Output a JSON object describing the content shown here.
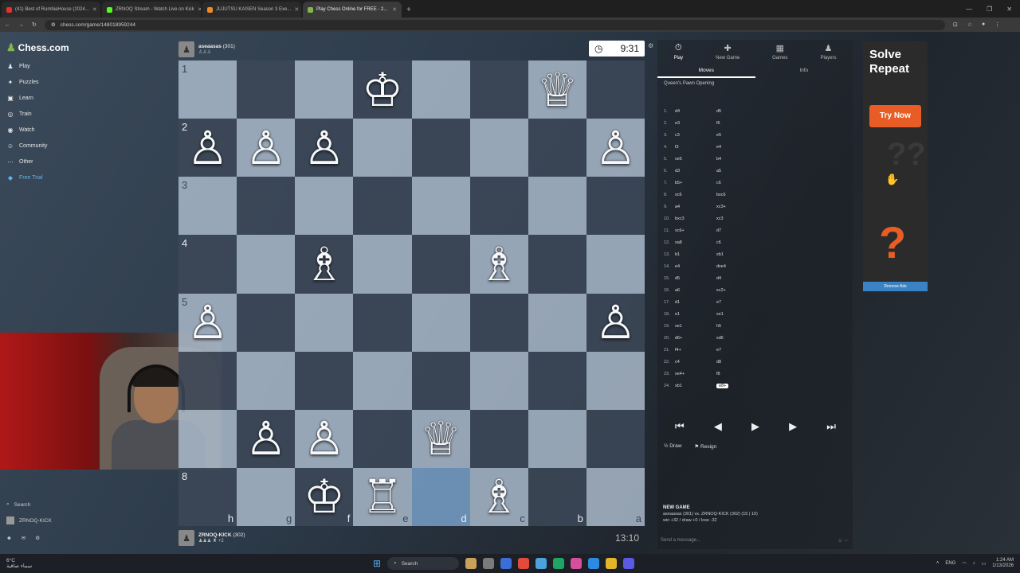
{
  "browser": {
    "tabs": [
      {
        "label": "(41) Best of RumbiaHouse (2024...",
        "color": "#e5322d",
        "active": false
      },
      {
        "label": "ZRNOQ Stream - Watch Live on Kick",
        "color": "#53fc18",
        "active": false
      },
      {
        "label": "JUJUTSU KAISEN Season 3 Exe...",
        "color": "#f08a24",
        "active": false
      },
      {
        "label": "Play Chess Online for FREE - 2...",
        "color": "#81b64c",
        "active": true
      }
    ],
    "new_tab": "+",
    "url": "chess.com/game/148018959244"
  },
  "sidebar": {
    "logo": "Chess.com",
    "items": [
      {
        "label": "Play",
        "icon": "play-icon",
        "glyph": "♟"
      },
      {
        "label": "Puzzles",
        "icon": "puzzle-icon",
        "glyph": "✦"
      },
      {
        "label": "Learn",
        "icon": "learn-icon",
        "glyph": "▣"
      },
      {
        "label": "Train",
        "icon": "train-icon",
        "glyph": "◎"
      },
      {
        "label": "Watch",
        "icon": "watch-icon",
        "glyph": "◉"
      },
      {
        "label": "Community",
        "icon": "community-icon",
        "glyph": "☺"
      },
      {
        "label": "Other",
        "icon": "more-icon",
        "glyph": "⋯"
      },
      {
        "label": "Free Trial",
        "icon": "diamond-icon",
        "glyph": "◆"
      }
    ],
    "search": "Search",
    "user": "ZRNOQ-KICK"
  },
  "board": {
    "ranks": [
      "1",
      "2",
      "3",
      "4",
      "5",
      "6",
      "7",
      "8"
    ],
    "files": [
      "h",
      "g",
      "f",
      "e",
      "d",
      "c",
      "b",
      "a"
    ],
    "rows": [
      [
        "",
        "",
        "",
        "♔",
        "",
        "",
        "♕",
        ""
      ],
      [
        "♙",
        "♙",
        "♙",
        "",
        "",
        "",
        "",
        "♙"
      ],
      [
        "",
        "",
        "",
        "",
        "",
        "",
        "",
        ""
      ],
      [
        "",
        "",
        "♗",
        "",
        "",
        "♗",
        "",
        ""
      ],
      [
        "♙",
        "",
        "",
        "",
        "",
        "",
        "",
        "♙"
      ],
      [
        "",
        "",
        "",
        "",
        "",
        "",
        "",
        ""
      ],
      [
        "",
        "♙",
        "♙",
        "",
        "♕",
        "",
        "",
        ""
      ],
      [
        "",
        "",
        "♔",
        "♖",
        "",
        "♗",
        "",
        ""
      ]
    ]
  },
  "top_player": {
    "name": "aseaasas",
    "rating": "(301)",
    "captured": "♙♙♙"
  },
  "bottom_player": {
    "name": "ZRNOQ-KICK",
    "rating": "(302)",
    "captured": "♟♟♟ ♜ +2"
  },
  "clocks": {
    "top": "9:31",
    "bottom": "13:10"
  },
  "panel": {
    "tabs": [
      {
        "label": "Play",
        "icon": "play-icon",
        "glyph": "⏱",
        "active": true
      },
      {
        "label": "New Game",
        "icon": "new-game-icon",
        "glyph": "✚",
        "active": false
      },
      {
        "label": "Games",
        "icon": "games-icon",
        "glyph": "▦",
        "active": false
      },
      {
        "label": "Players",
        "icon": "players-icon",
        "glyph": "♟",
        "active": false
      }
    ],
    "subtabs": [
      "Moves",
      "Info"
    ],
    "opening": "Queen's Pawn Opening",
    "moves": [
      {
        "n": "1.",
        "w": "d4",
        "b": "d5"
      },
      {
        "n": "2.",
        "w": "e3",
        "b": "f6"
      },
      {
        "n": "3.",
        "w": "c3",
        "b": "e5"
      },
      {
        "n": "4.",
        "w": "f3",
        "b": "e4"
      },
      {
        "n": "5.",
        "w": "xe5",
        "b": "b4"
      },
      {
        "n": "6.",
        "w": "d3",
        "b": "a5"
      },
      {
        "n": "7.",
        "w": "b5+",
        "b": "c6"
      },
      {
        "n": "8.",
        "w": "xc6",
        "b": "bxc6"
      },
      {
        "n": "9.",
        "w": "a4",
        "b": "xc3+"
      },
      {
        "n": "10.",
        "w": "bxc3",
        "b": "xc3"
      },
      {
        "n": "11.",
        "w": "xc6+",
        "b": "d7"
      },
      {
        "n": "12.",
        "w": "xa8",
        "b": "c6"
      },
      {
        "n": "13.",
        "w": "b1",
        "b": "xb1"
      },
      {
        "n": "14.",
        "w": "e4",
        "b": "dxe4"
      },
      {
        "n": "15.",
        "w": "d5",
        "b": "d4"
      },
      {
        "n": "16.",
        "w": "a6",
        "b": "xc2+"
      },
      {
        "n": "17.",
        "w": "d1",
        "b": "e7"
      },
      {
        "n": "18.",
        "w": "e1",
        "b": "xe1"
      },
      {
        "n": "19.",
        "w": "xe1",
        "b": "h5"
      },
      {
        "n": "20.",
        "w": "d6+",
        "b": "xd6"
      },
      {
        "n": "21.",
        "w": "f4+",
        "b": "e7"
      },
      {
        "n": "22.",
        "w": "c4",
        "b": "d8"
      },
      {
        "n": "23.",
        "w": "xe4+",
        "b": "f8"
      },
      {
        "n": "24.",
        "w": "xb1",
        "b": "e8+"
      }
    ],
    "controls": [
      "⏮",
      "◀",
      "▶",
      "▶",
      "⏭"
    ],
    "draw": "Draw",
    "resign": "Resign",
    "new_game_title": "NEW GAME",
    "new_game_line1": "aseaasas (301) vs. ZRNOQ-KICK (302) (15 | 10)",
    "new_game_line2": "win +32 / draw +0 / lose -32",
    "message_placeholder": "Send a message..."
  },
  "ad": {
    "title_line1": "Solve",
    "title_line2": "Repeat",
    "button": "Try Now",
    "question": "?",
    "remove": "Remove Ads"
  },
  "taskbar": {
    "temp": "6°C",
    "weather": "سماء صافية",
    "search": "Search",
    "lang": "ENG",
    "time": "1:24 AM",
    "date": "1/13/2026"
  }
}
